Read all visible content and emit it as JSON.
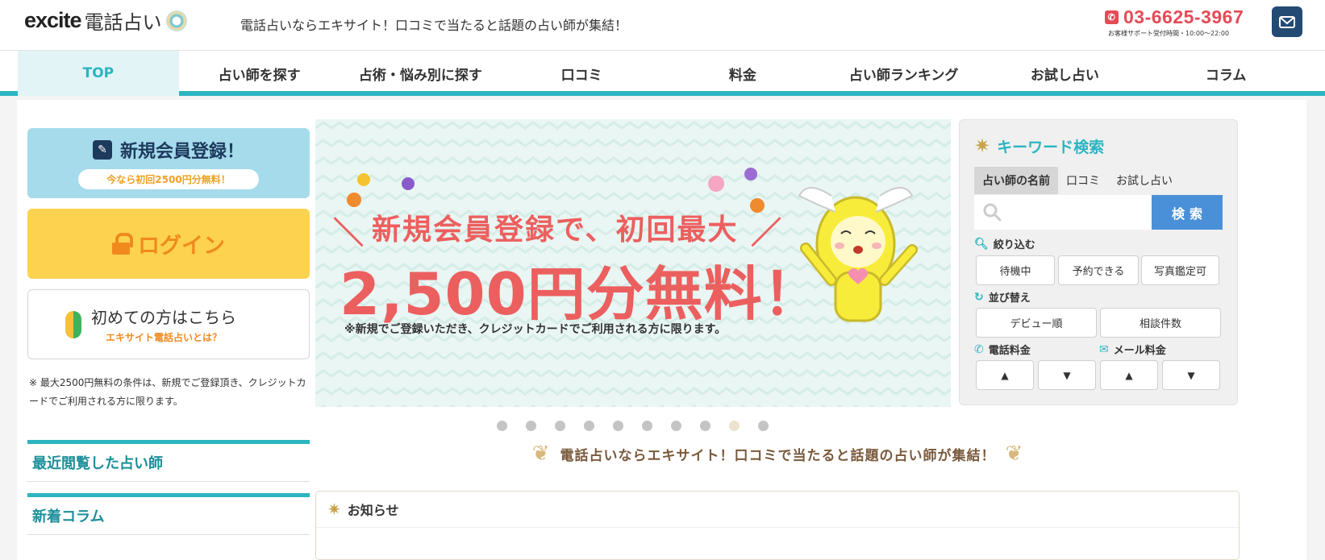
{
  "header": {
    "logo_main": "excite",
    "logo_sub": "電話占い",
    "tagline": "電話占いならエキサイト！口コミで当たると話題の占い師が集結！",
    "tel": "03-6625-3967",
    "tel_hours": "お客様サポート受付時間・10:00～22:00"
  },
  "nav": {
    "items": [
      "TOP",
      "占い師を探す",
      "占術・悩み別に探す",
      "口コミ",
      "料金",
      "占い師ランキング",
      "お試し占い",
      "コラム"
    ]
  },
  "sidebar": {
    "register_title": "新規会員登録！",
    "register_sub": "今なら初回2500円分無料！",
    "login_label": "ログイン",
    "first_title": "初めての方はこちら",
    "first_sub": "エキサイト電話占いとは？",
    "note": "※ 最大2500円無料の条件は、新規でご登録頂き、クレジットカードでご利用される方に限ります。",
    "section_recent": "最近閲覧した占い師",
    "section_column": "新着コラム"
  },
  "banner": {
    "line1": "新規会員登録で、初回最大",
    "line2": "2,500円分無料！",
    "note": "※新規でご登録いただき、クレジットカードでご利用される方に限ります。",
    "dot_count": 10,
    "active_dot": 8
  },
  "catchphrase": "電話占いならエキサイト！口コミで当たると話題の占い師が集結！",
  "news": {
    "title": "お知らせ"
  },
  "search": {
    "title": "キーワード検索",
    "tabs": [
      "占い師の名前",
      "口コミ",
      "お試し占い"
    ],
    "input_value": "",
    "button": "検索",
    "filter_label": "絞り込む",
    "filters": [
      "待機中",
      "予約できる",
      "写真鑑定可"
    ],
    "sort_label": "並び替え",
    "sorts": [
      "デビュー順",
      "相談件数"
    ],
    "tel_price_label": "電話料金",
    "mail_price_label": "メール料金",
    "up": "▲",
    "down": "▼"
  }
}
